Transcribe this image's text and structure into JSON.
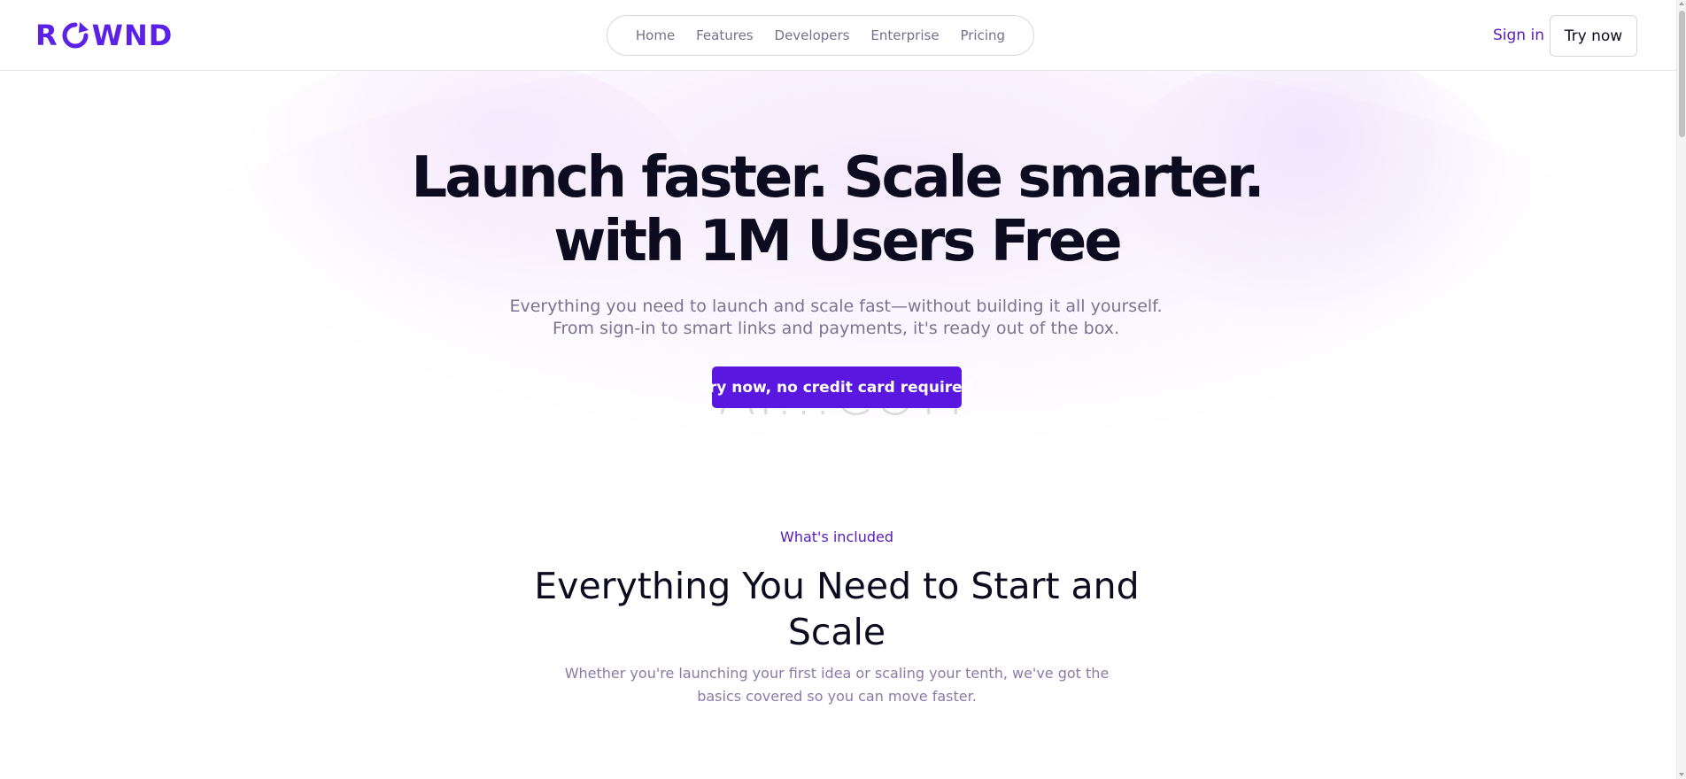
{
  "header": {
    "logo_text": "ROWND",
    "nav": [
      "Home",
      "Features",
      "Developers",
      "Enterprise",
      "Pricing"
    ],
    "sign_in": "Sign in",
    "try_now": "Try now"
  },
  "hero": {
    "title_line1": "Launch faster. Scale smarter.",
    "title_line2": "with 1M Users Free",
    "subtitle_line1": "Everything you need to launch and scale fast—without building it all yourself.",
    "subtitle_line2": "From sign-in to smart links and payments, it's ready out of the box.",
    "cta": "Try now, no credit card required",
    "watermark": "AI...COM"
  },
  "included": {
    "eyebrow": "What's included",
    "title": "Everything You Need to Start and Scale",
    "subtitle": "Whether you're launching your first idea or scaling your tenth, we've got the basics covered so you can move faster."
  },
  "colors": {
    "brand": "#5b21e6",
    "cta_bg": "#5a17e0",
    "heading": "#0d0b1f",
    "muted": "#7a7392"
  }
}
